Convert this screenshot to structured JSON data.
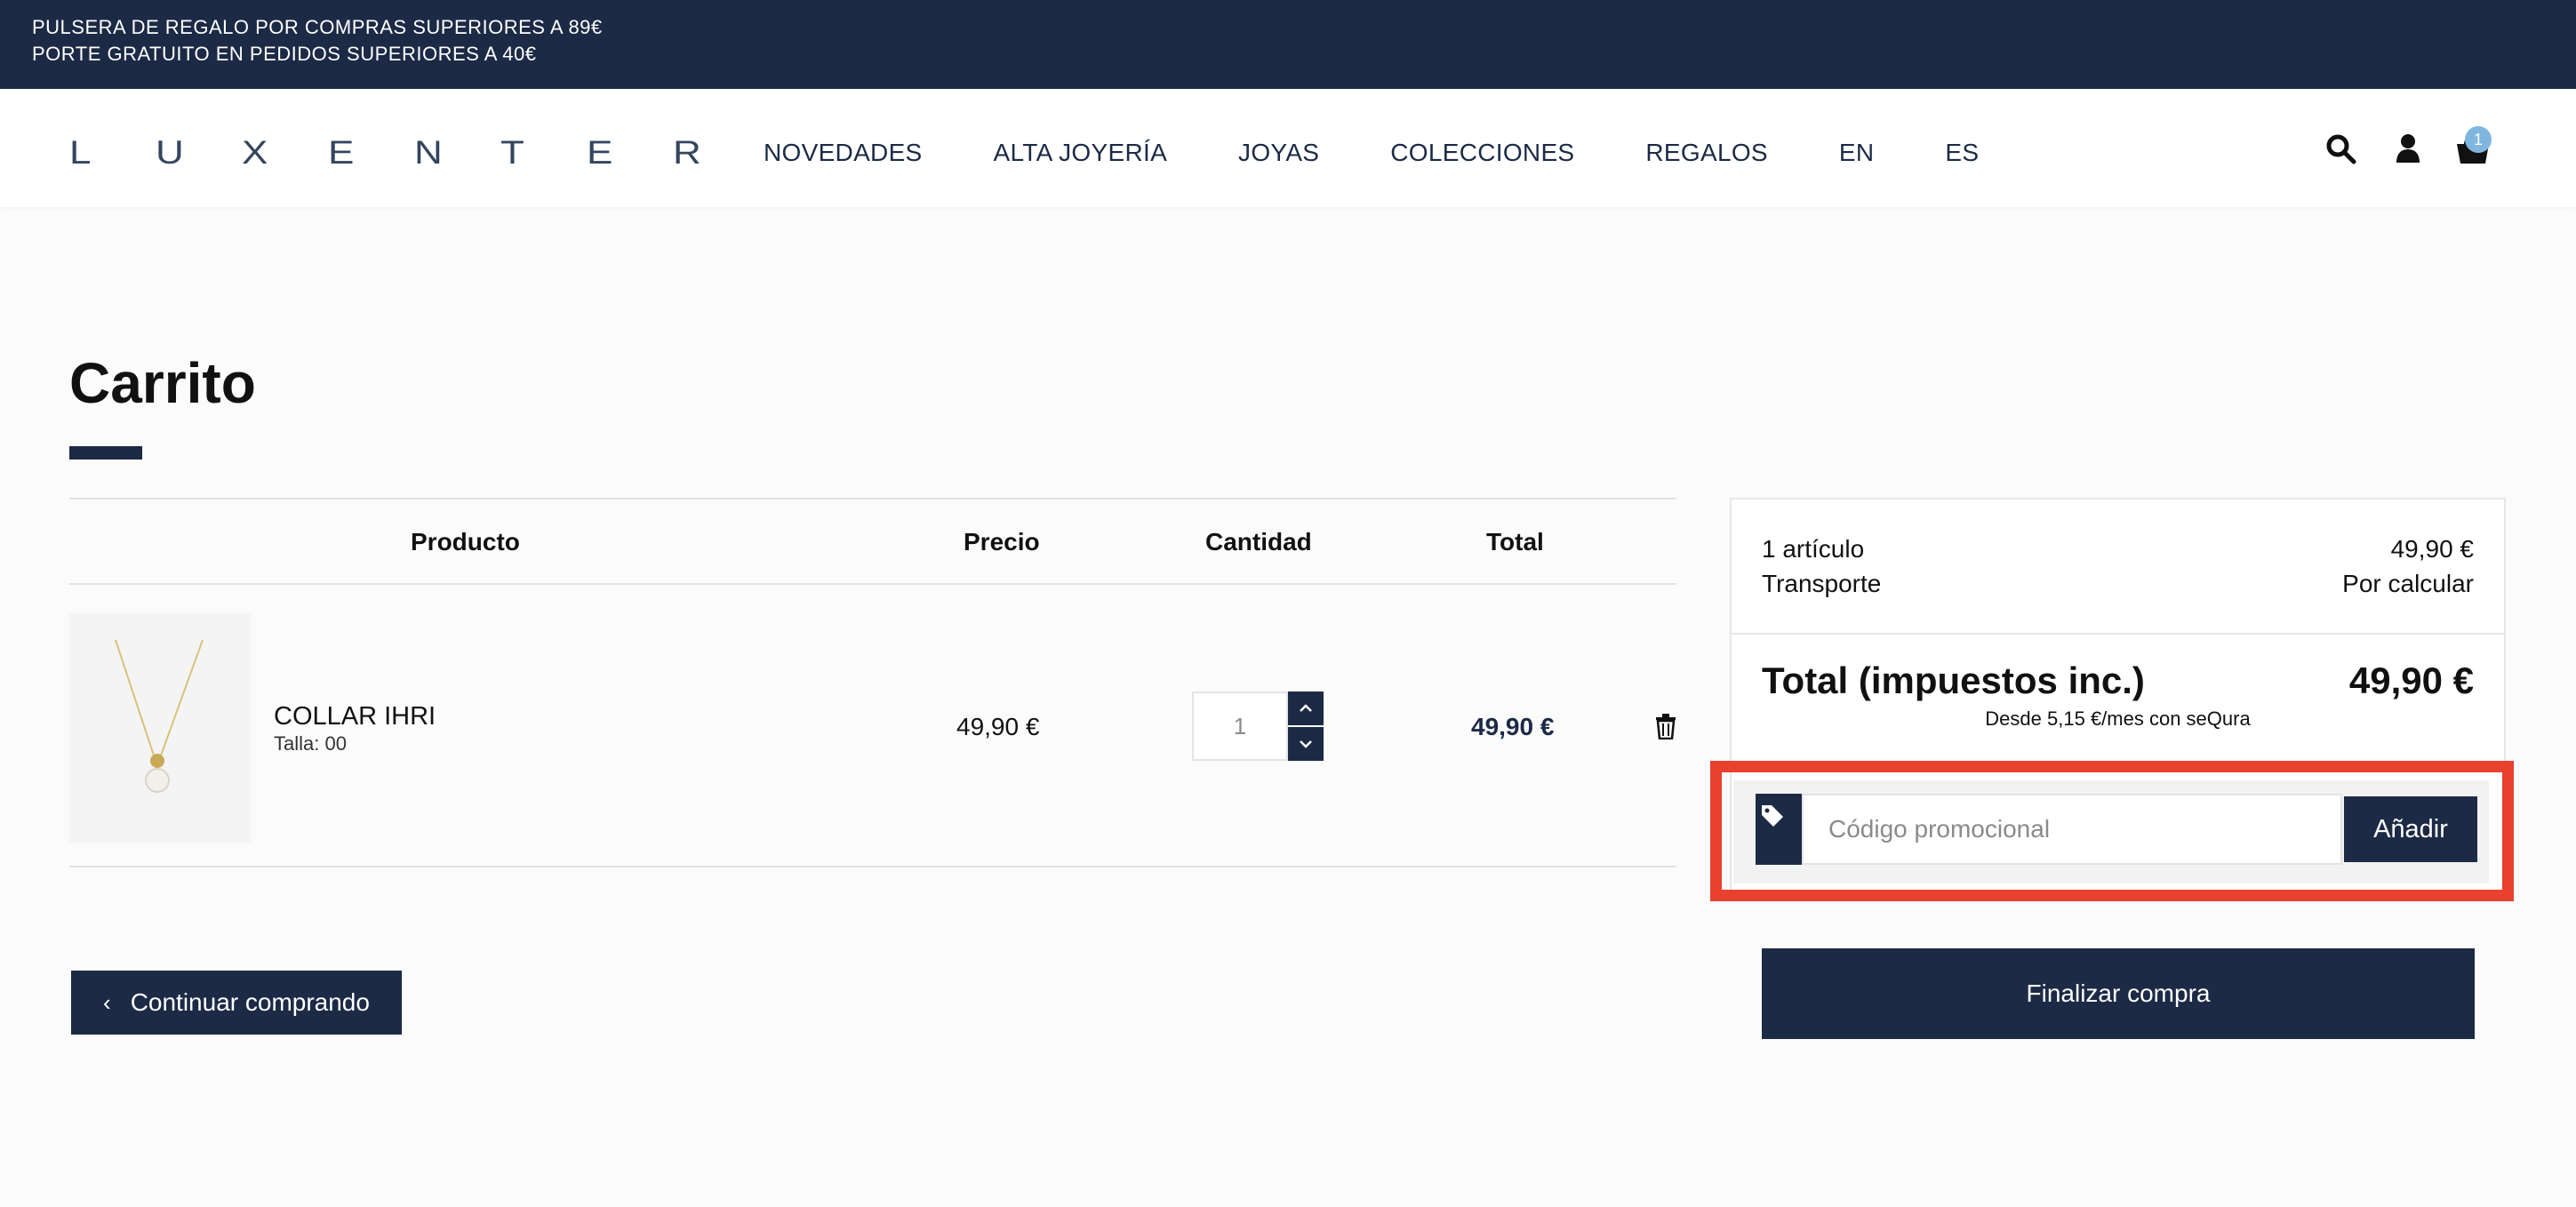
{
  "promo_bar": {
    "line1": "PULSERA DE REGALO POR COMPRAS SUPERIORES A 89€",
    "line2": "PORTE GRATUITO EN PEDIDOS SUPERIORES A 40€"
  },
  "header": {
    "logo_letters": [
      "L",
      "U",
      "X",
      "E",
      "N",
      "T",
      "E",
      "R"
    ],
    "nav": [
      "NOVEDADES",
      "ALTA JOYERÍA",
      "JOYAS",
      "COLECCIONES",
      "REGALOS",
      "EN",
      "ES"
    ],
    "cart_count": "1",
    "icons": [
      "search-icon",
      "user-icon",
      "cart-icon"
    ]
  },
  "page": {
    "title": "Carrito"
  },
  "table": {
    "columns": [
      "Producto",
      "Precio",
      "Cantidad",
      "Total"
    ],
    "rows": [
      {
        "name": "COLLAR IHRI",
        "size": "Talla: 00",
        "price": "49,90 €",
        "quantity": "1",
        "total": "49,90 €"
      }
    ]
  },
  "continue_button": "Continuar comprando",
  "summary": {
    "items_label": "1 artículo",
    "items_value": "49,90 €",
    "shipping_label": "Transporte",
    "shipping_value": "Por calcular",
    "total_label": "Total (impuestos inc.)",
    "total_value": "49,90 €",
    "sequra_text": "Desde 5,15 €/mes con seQura"
  },
  "promo": {
    "placeholder": "Código promocional",
    "add_label": "Añadir"
  },
  "checkout_button": "Finalizar compra",
  "colors": {
    "brand_navy": "#1c2a46",
    "highlight": "#e8412d",
    "badge": "#7fb6e0"
  }
}
